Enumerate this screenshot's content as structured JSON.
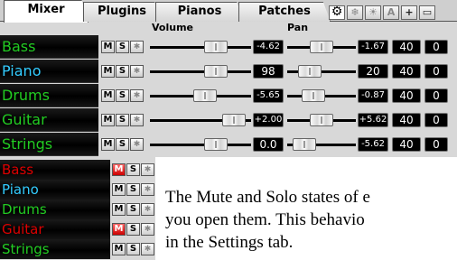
{
  "tabs": [
    {
      "label": "Mixer",
      "active": true
    },
    {
      "label": "Plugins",
      "active": false
    },
    {
      "label": "Pianos",
      "active": false
    },
    {
      "label": "Patches",
      "active": false
    }
  ],
  "toolbar": {
    "icons": [
      "gear-icon",
      "snowflake-icon",
      "sun-icon",
      "font-a-icon",
      "plus-icon",
      "window-icon"
    ],
    "a_label": "A",
    "plus_label": "+"
  },
  "headers": {
    "volume": "Volume",
    "pan": "Pan"
  },
  "mixer_tracks": [
    {
      "name": "Bass",
      "color": "#22cc22",
      "volume": "-4.62",
      "pan": "-1.67",
      "reverb": "40",
      "extra": "0"
    },
    {
      "name": "Piano",
      "color": "#33ccff",
      "volume": "98",
      "pan": "20",
      "reverb": "40",
      "extra": "0"
    },
    {
      "name": "Drums",
      "color": "#22cc22",
      "volume": "-5.65",
      "pan": "-0.87",
      "reverb": "40",
      "extra": "0"
    },
    {
      "name": "Guitar",
      "color": "#22cc22",
      "volume": "+2.00",
      "pan": "+5.62",
      "reverb": "40",
      "extra": "0"
    },
    {
      "name": "Strings",
      "color": "#22cc22",
      "volume": "0.0",
      "pan": "-5.62",
      "reverb": "40",
      "extra": "0"
    }
  ],
  "mute_solo": {
    "mute": "M",
    "solo": "S"
  },
  "state_tracks": [
    {
      "name": "Bass",
      "color": "#dd0000",
      "muted": true
    },
    {
      "name": "Piano",
      "color": "#33ccff",
      "muted": false
    },
    {
      "name": "Drums",
      "color": "#22cc22",
      "muted": false
    },
    {
      "name": "Guitar",
      "color": "#dd0000",
      "muted": true
    },
    {
      "name": "Strings",
      "color": "#22cc22",
      "muted": false
    }
  ],
  "description": {
    "line1": "The Mute and Solo states of e",
    "line2": "you open them.  This behavio",
    "line3": "in the Settings tab."
  }
}
